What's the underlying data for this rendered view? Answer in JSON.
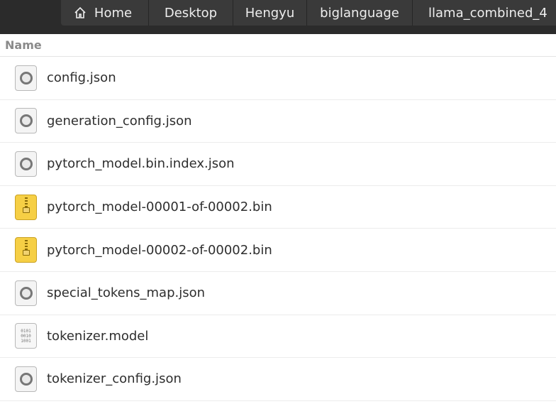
{
  "breadcrumb": {
    "items": [
      {
        "label": "Home",
        "icon": "home-icon"
      },
      {
        "label": "Desktop"
      },
      {
        "label": "Hengyu"
      },
      {
        "label": "biglanguage"
      },
      {
        "label": "llama_combined_4"
      }
    ]
  },
  "list": {
    "column_name": "Name",
    "files": [
      {
        "name": "config.json",
        "icon": "json-file-icon"
      },
      {
        "name": "generation_config.json",
        "icon": "json-file-icon"
      },
      {
        "name": "pytorch_model.bin.index.json",
        "icon": "json-file-icon"
      },
      {
        "name": "pytorch_model-00001-of-00002.bin",
        "icon": "archive-file-icon"
      },
      {
        "name": "pytorch_model-00002-of-00002.bin",
        "icon": "archive-file-icon"
      },
      {
        "name": "special_tokens_map.json",
        "icon": "json-file-icon"
      },
      {
        "name": "tokenizer.model",
        "icon": "binary-file-icon"
      },
      {
        "name": "tokenizer_config.json",
        "icon": "json-file-icon"
      }
    ],
    "binary_icon_text": [
      "0101",
      "0010",
      "1001"
    ]
  },
  "colors": {
    "topbar": "#2b2b2b",
    "crumb_bg": "#3a3a3a",
    "archive_icon": "#f6cf45"
  }
}
